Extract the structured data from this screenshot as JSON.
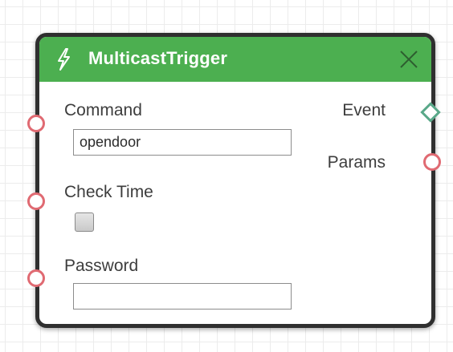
{
  "node": {
    "title": "MulticastTrigger",
    "header_color": "#4caf50",
    "header_icon": "lightning-bolt-icon",
    "close_icon": "close-x-icon",
    "inputs": {
      "command": {
        "label": "Command",
        "value": "opendoor",
        "port_color": "#e06a72"
      },
      "check_time": {
        "label": "Check Time",
        "checked": false,
        "port_color": "#e06a72"
      },
      "password": {
        "label": "Password",
        "value": "",
        "port_color": "#e06a72"
      }
    },
    "outputs": {
      "event": {
        "label": "Event",
        "port_shape": "diamond",
        "port_color": "#59a889"
      },
      "params": {
        "label": "Params",
        "port_shape": "circle",
        "port_color": "#e06a72"
      }
    }
  }
}
